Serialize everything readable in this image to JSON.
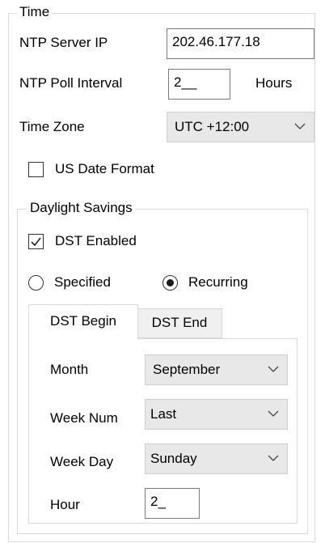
{
  "time_group": {
    "legend": "Time",
    "ntp_server_ip": {
      "label": "NTP Server IP",
      "value": "202.46.177.18"
    },
    "ntp_poll_interval": {
      "label": "NTP Poll Interval",
      "value": "2__",
      "unit": "Hours"
    },
    "time_zone": {
      "label": "Time Zone",
      "selected": "UTC +12:00",
      "icon": "chevron-down-icon"
    },
    "us_date_format": {
      "label": "US Date Format",
      "checked": false
    }
  },
  "daylight_savings": {
    "legend": "Daylight Savings",
    "dst_enabled": {
      "label": "DST Enabled",
      "checked": true,
      "icon": "checkmark-icon"
    },
    "mode": {
      "specified_label": "Specified",
      "recurring_label": "Recurring",
      "selected": "Recurring"
    },
    "tabs": [
      {
        "label": "DST Begin",
        "active": true
      },
      {
        "label": "DST End",
        "active": false
      }
    ],
    "dst_begin": {
      "month": {
        "label": "Month",
        "selected": "September"
      },
      "week_num": {
        "label": "Week Num",
        "selected": "Last"
      },
      "week_day": {
        "label": "Week Day",
        "selected": "Sunday"
      },
      "hour": {
        "label": "Hour",
        "value": "2_"
      }
    }
  },
  "colors": {
    "text": "#000000",
    "combo_bg": "#e8e8e8",
    "border": "#7a7a7a",
    "group_border": "#dcdcdc"
  }
}
